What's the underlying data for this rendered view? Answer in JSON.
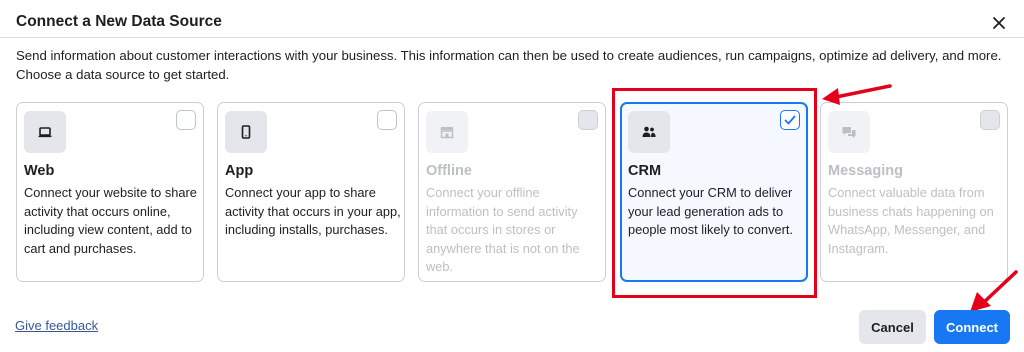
{
  "dialog": {
    "title": "Connect a New Data Source",
    "description": "Send information about customer interactions with your business. This information can then be used to create audiences, run campaigns, optimize ad delivery, and more. Choose a data source to get started."
  },
  "cards": [
    {
      "title": "Web",
      "description": "Connect your website to share activity that occurs online, including view content, add to cart and purchases.",
      "icon": "laptop-icon",
      "selected": false,
      "disabled": false
    },
    {
      "title": "App",
      "description": "Connect your app to share activity that occurs in your app, including installs, purchases.",
      "icon": "phone-icon",
      "selected": false,
      "disabled": false
    },
    {
      "title": "Offline",
      "description": "Connect your offline information to send activity that occurs in stores or anywhere that is not on the web.",
      "icon": "store-icon",
      "selected": false,
      "disabled": true
    },
    {
      "title": "CRM",
      "description": "Connect your CRM to deliver your lead generation ads to people most likely to convert.",
      "icon": "people-icon",
      "selected": true,
      "disabled": false
    },
    {
      "title": "Messaging",
      "description": "Connect valuable data from business chats happening on WhatsApp, Messenger, and Instagram.",
      "icon": "chat-icon",
      "selected": false,
      "disabled": true
    }
  ],
  "footer": {
    "feedback_label": "Give feedback",
    "cancel_label": "Cancel",
    "connect_label": "Connect"
  },
  "colors": {
    "primary": "#1877f2",
    "annotation": "#e4001b",
    "disabled_text": "#bcc0c4"
  }
}
